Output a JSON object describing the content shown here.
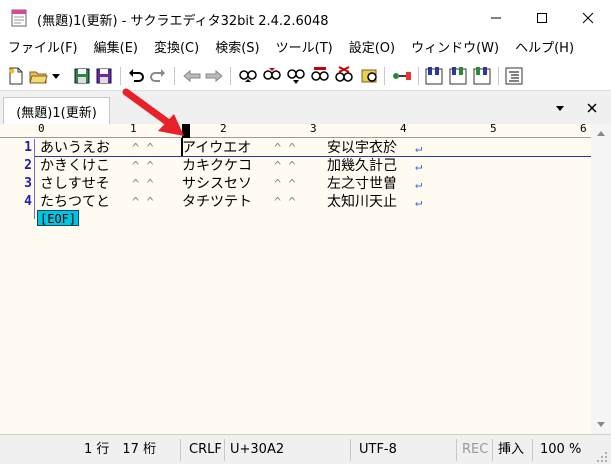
{
  "window": {
    "title": "(無題)1(更新) - サクラエディタ32bit 2.4.2.6048",
    "icons": {
      "app": "sakura-app-icon",
      "minimize": "minimize-icon",
      "maximize": "maximize-icon",
      "close": "close-icon"
    }
  },
  "menubar": {
    "items": [
      {
        "label": "ファイル(F)"
      },
      {
        "label": "編集(E)"
      },
      {
        "label": "変換(C)"
      },
      {
        "label": "検索(S)"
      },
      {
        "label": "ツール(T)"
      },
      {
        "label": "設定(O)"
      },
      {
        "label": "ウィンドウ(W)"
      },
      {
        "label": "ヘルプ(H)"
      }
    ]
  },
  "toolbar": {
    "buttons": [
      "new-file-icon",
      "open-folder-icon",
      "dropdown-icon",
      "save-icon",
      "save-all-icon",
      "undo-icon",
      "redo-icon",
      "jump-prev-icon",
      "jump-next-icon",
      "search-prev-icon",
      "search-next-icon",
      "search-down-icon",
      "replace-icon",
      "clear-mark-icon",
      "grep-icon",
      "tag-jump-icon",
      "bookmark-toggle-icon",
      "bookmark-next-icon",
      "bookmark-prev-icon",
      "outline-icon"
    ]
  },
  "tabs": {
    "active_label": "(無題)1(更新)",
    "menu_icon": "tab-list-icon",
    "close_icon": "close-icon"
  },
  "ruler": {
    "labels": [
      "0",
      "1",
      "2",
      "3",
      "4",
      "5",
      "6"
    ]
  },
  "editor": {
    "lines": [
      {
        "number": "1",
        "col1": "あいうえお",
        "col2": "アイウエオ",
        "col3": "安以宇衣於"
      },
      {
        "number": "2",
        "col1": "かきくけこ",
        "col2": "カキクケコ",
        "col3": "加幾久計己"
      },
      {
        "number": "3",
        "col1": "さしすせそ",
        "col2": "サシスセソ",
        "col3": "左之寸世曽"
      },
      {
        "number": "4",
        "col1": "たちつてと",
        "col2": "タチツテト",
        "col3": "太知川天止"
      }
    ],
    "tab_marker": "^ ^",
    "eol_marker": "↵",
    "eof_label": "[EOF]"
  },
  "statusbar": {
    "position": "1 行　17 桁",
    "newline": "CRLF",
    "codepoint": "U+30A2",
    "encoding": "UTF-8",
    "rec": "REC",
    "insert_mode": "挿入",
    "zoom": "100 %"
  },
  "colors": {
    "editor_background": "#fffbf0",
    "line_number": "#1e1eb4",
    "eof_background": "#00c4e0",
    "annotation_arrow": "#e8202a"
  }
}
